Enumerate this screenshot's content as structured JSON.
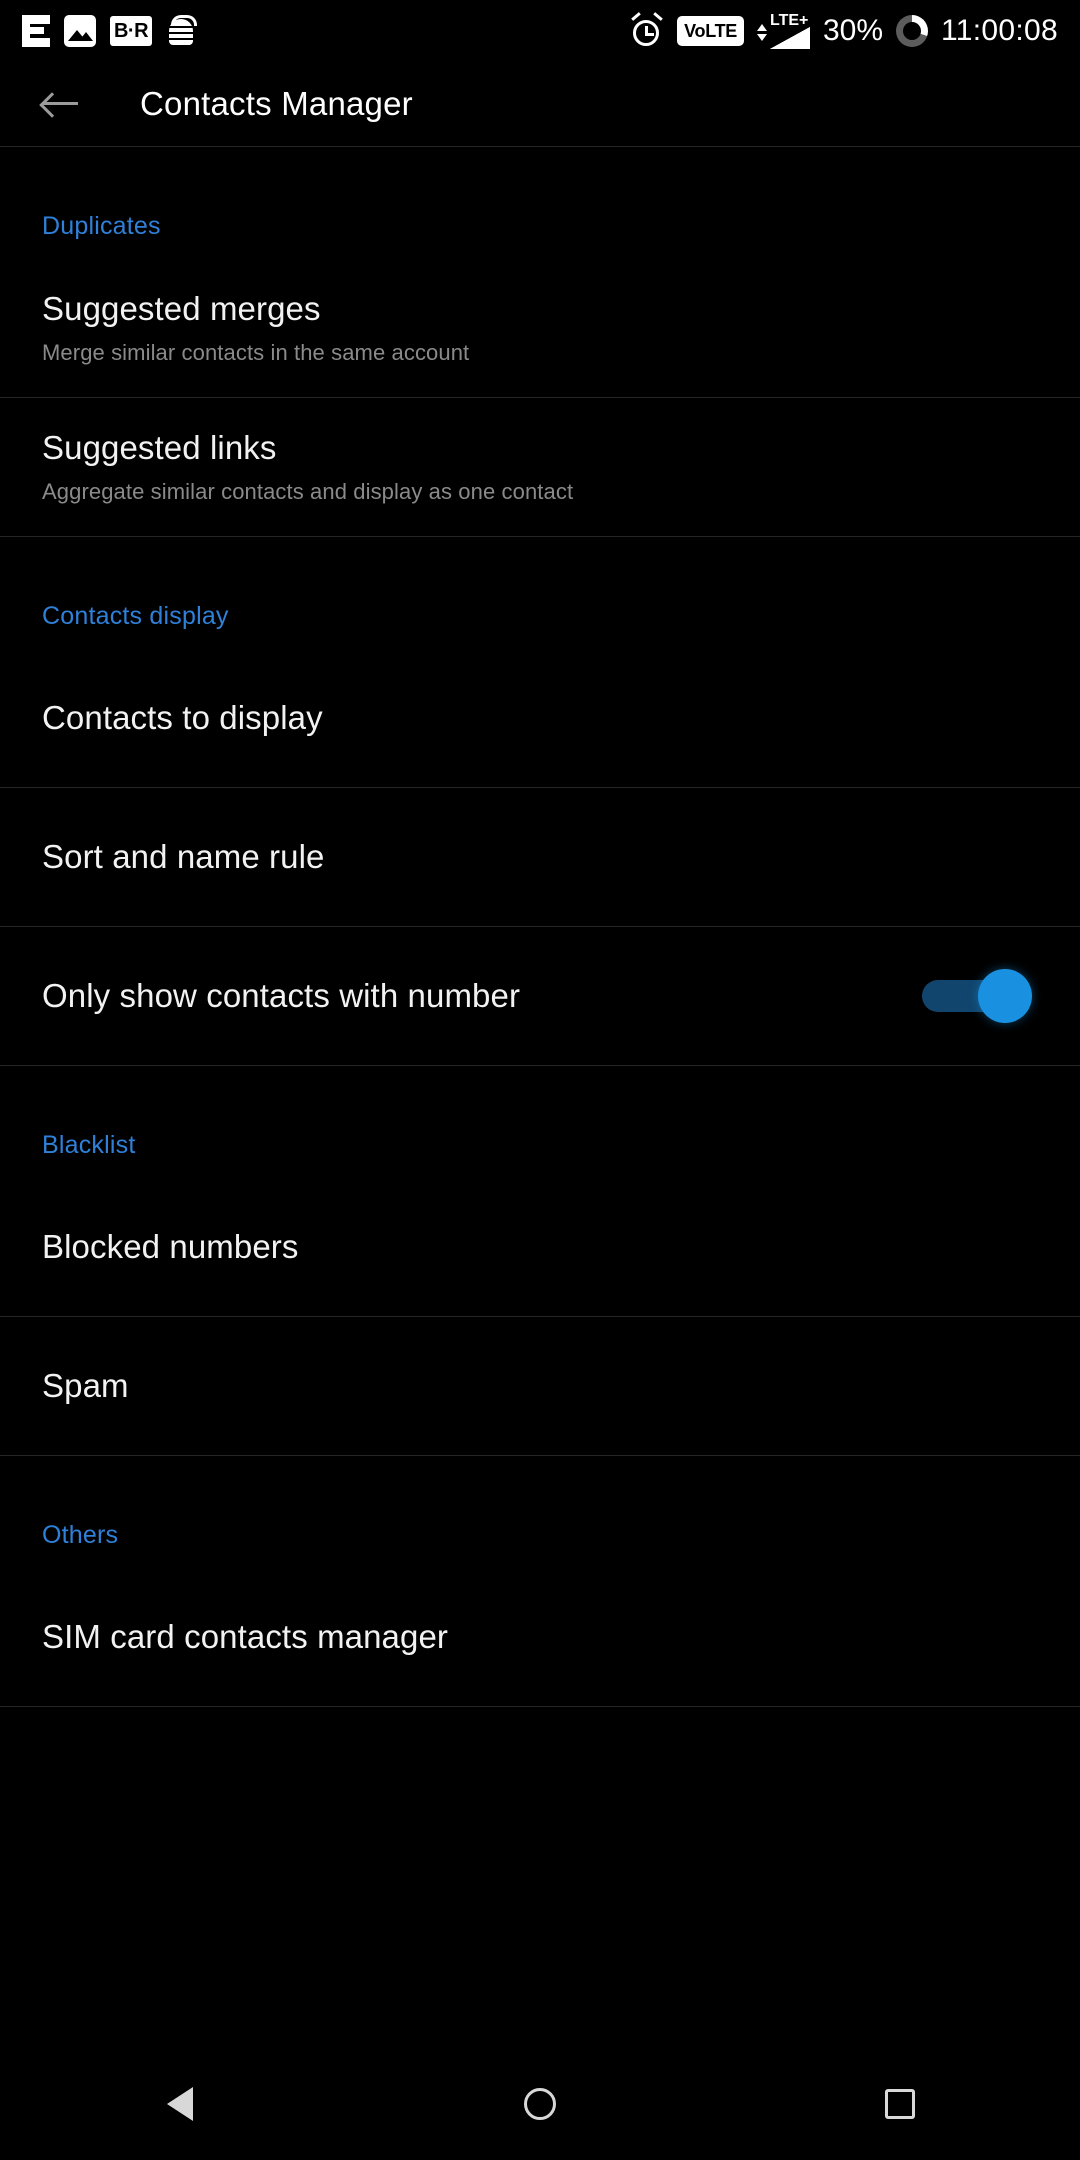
{
  "status_bar": {
    "left_icons": [
      {
        "name": "notification-e-icon",
        "label": "E"
      },
      {
        "name": "photo-icon",
        "label": "Photo"
      },
      {
        "name": "br-badge-icon",
        "label": "B·R"
      },
      {
        "name": "android-bug-icon",
        "label": "Bug"
      }
    ],
    "alarm_icon": "alarm-icon",
    "volte_label": "VoLTE",
    "network_label": "LTE+",
    "battery_percent": "30%",
    "battery_level": 30,
    "clock": "11:00:08"
  },
  "app_bar": {
    "back_label": "Back",
    "title": "Contacts Manager"
  },
  "sections": [
    {
      "header": "Duplicates",
      "items": [
        {
          "title": "Suggested merges",
          "subtitle": "Merge similar contacts in the same account",
          "type": "link"
        },
        {
          "title": "Suggested links",
          "subtitle": "Aggregate similar contacts and display as one contact",
          "type": "link"
        }
      ]
    },
    {
      "header": "Contacts display",
      "items": [
        {
          "title": "Contacts to display",
          "subtitle": "",
          "type": "link"
        },
        {
          "title": "Sort and name rule",
          "subtitle": "",
          "type": "link"
        },
        {
          "title": "Only show contacts with number",
          "subtitle": "",
          "type": "switch",
          "value": "on"
        }
      ]
    },
    {
      "header": "Blacklist",
      "items": [
        {
          "title": "Blocked numbers",
          "subtitle": "",
          "type": "link"
        },
        {
          "title": "Spam",
          "subtitle": "",
          "type": "link"
        }
      ]
    },
    {
      "header": "Others",
      "items": [
        {
          "title": "SIM card contacts manager",
          "subtitle": "",
          "type": "link"
        }
      ]
    }
  ],
  "nav_bar": {
    "back": "Back",
    "home": "Home",
    "recents": "Recents"
  },
  "colors": {
    "background": "#000000",
    "accent": "#2f80d8",
    "switch_on": "#1a91e0",
    "switch_track": "#11456e",
    "primary_text": "#f2f2f2",
    "secondary_text": "#8a8a8a",
    "divider": "#262626"
  }
}
